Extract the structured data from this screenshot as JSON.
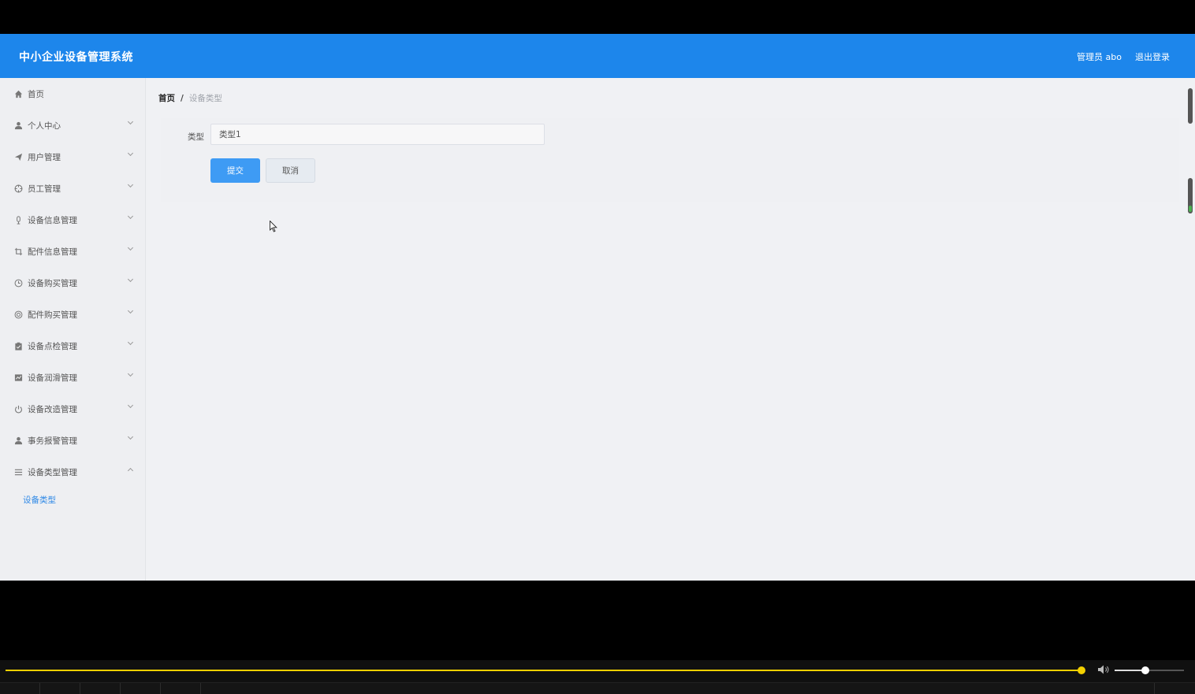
{
  "header": {
    "app_title": "中小企业设备管理系统",
    "user_label": "管理员 abo",
    "logout_label": "退出登录",
    "bg_color": "#1d86eb"
  },
  "sidebar": {
    "items": [
      {
        "label": "首页",
        "icon": "home-icon",
        "expandable": false
      },
      {
        "label": "个人中心",
        "icon": "user-icon",
        "expandable": true
      },
      {
        "label": "用户管理",
        "icon": "send-icon",
        "expandable": true
      },
      {
        "label": "员工管理",
        "icon": "target-icon",
        "expandable": true
      },
      {
        "label": "设备信息管理",
        "icon": "microphone-icon",
        "expandable": true
      },
      {
        "label": "配件信息管理",
        "icon": "crop-icon",
        "expandable": true
      },
      {
        "label": "设备购买管理",
        "icon": "clock-icon",
        "expandable": true
      },
      {
        "label": "配件购买管理",
        "icon": "globe-icon",
        "expandable": true
      },
      {
        "label": "设备点检管理",
        "icon": "clipboard-icon",
        "expandable": true
      },
      {
        "label": "设备润滑管理",
        "icon": "chart-icon",
        "expandable": true
      },
      {
        "label": "设备改造管理",
        "icon": "power-icon",
        "expandable": true
      },
      {
        "label": "事务报警管理",
        "icon": "person-icon",
        "expandable": true
      },
      {
        "label": "设备类型管理",
        "icon": "list-icon",
        "expandable": true,
        "expanded": true
      }
    ],
    "active_sub_item": "设备类型"
  },
  "breadcrumb": {
    "home": "首页",
    "separator": "/",
    "current": "设备类型"
  },
  "form": {
    "type_label": "类型",
    "type_value": "类型1",
    "submit_label": "提交",
    "cancel_label": "取消",
    "submit_color": "#3e9bf4"
  },
  "player": {
    "accent_color": "#f3d000",
    "progress": 0.995,
    "volume": 0.45
  }
}
